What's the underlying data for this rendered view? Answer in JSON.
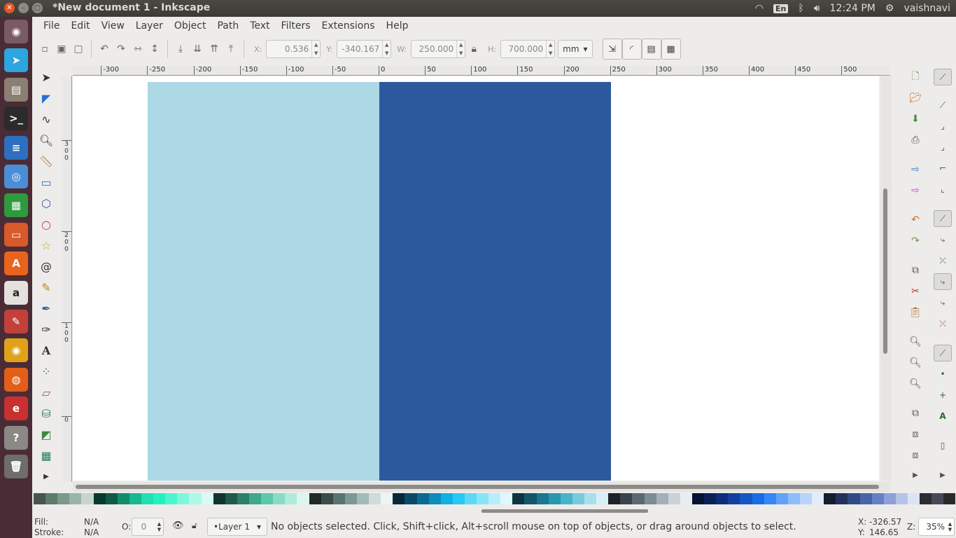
{
  "window": {
    "title": "*New document 1 - Inkscape"
  },
  "tray": {
    "lang": "En",
    "volume_icon": "speaker-icon",
    "time": "12:24 PM",
    "user": "vaishnavi"
  },
  "launcher": {
    "apps": [
      {
        "name": "ubuntu-dash",
        "glyph": "◉",
        "color": "#7a5a66"
      },
      {
        "name": "telegram",
        "glyph": "➤",
        "color": "#2ca5e0"
      },
      {
        "name": "files",
        "glyph": "▤",
        "color": "#8a7f72"
      },
      {
        "name": "terminal",
        "glyph": ">_",
        "color": "#2b2b2b"
      },
      {
        "name": "writer",
        "glyph": "≡",
        "color": "#2f6fbf"
      },
      {
        "name": "chromium",
        "glyph": "◎",
        "color": "#4a8fd6"
      },
      {
        "name": "calc",
        "glyph": "▦",
        "color": "#2e9a3e"
      },
      {
        "name": "impress",
        "glyph": "▭",
        "color": "#d8592a"
      },
      {
        "name": "software",
        "glyph": "A",
        "color": "#e8641e"
      },
      {
        "name": "amazon",
        "glyph": "a",
        "color": "#e4e1dc"
      },
      {
        "name": "settings",
        "glyph": "✎",
        "color": "#c2413a"
      },
      {
        "name": "chrome",
        "glyph": "◉",
        "color": "#e1a21b"
      },
      {
        "name": "firefox",
        "glyph": "◍",
        "color": "#e25f1a"
      },
      {
        "name": "evince",
        "glyph": "e",
        "color": "#c8312f"
      },
      {
        "name": "help",
        "glyph": "?",
        "color": "#8a8984"
      },
      {
        "name": "trash",
        "glyph": "🗑",
        "color": "#6e6d68"
      }
    ]
  },
  "menu": [
    "File",
    "Edit",
    "View",
    "Layer",
    "Object",
    "Path",
    "Text",
    "Filters",
    "Extensions",
    "Help"
  ],
  "controls": {
    "x_label": "X:",
    "x": "0.536",
    "y_label": "Y:",
    "y": "-340.167",
    "w_label": "W:",
    "w": "250.000",
    "h_label": "H:",
    "h": "700.000",
    "unit": "mm"
  },
  "ruler_top": [
    "-300",
    "-250",
    "-200",
    "-150",
    "-100",
    "-50",
    "0",
    "50",
    "100",
    "150",
    "200",
    "250",
    "300",
    "350",
    "400",
    "450",
    "500"
  ],
  "ruler_left": [
    "3\n0\n0",
    "2\n0\n0",
    "1\n0\n0",
    "0"
  ],
  "canvas": {
    "rect_light_color": "#add8e6",
    "rect_dark_color": "#2c599d"
  },
  "palette": [
    "#46564f",
    "#5d7a6a",
    "#7a9a8a",
    "#9ab5a8",
    "#c6d6ce",
    "#063a2e",
    "#0e5a44",
    "#128c6c",
    "#18b890",
    "#20e0b2",
    "#26f0c2",
    "#4ef4d0",
    "#80f6dc",
    "#b0f8e8",
    "#d8fbf3",
    "#10342e",
    "#1e5a4c",
    "#2a8068",
    "#3ea88c",
    "#5cc8ac",
    "#86dcc4",
    "#b0eada",
    "#dcf6ee",
    "#1e2a28",
    "#3a4c48",
    "#587470",
    "#7c9894",
    "#a4bab6",
    "#cedcda",
    "#eef4f3",
    "#08283a",
    "#0a4a66",
    "#0c6a92",
    "#0e8cbc",
    "#10b0e6",
    "#28c8f4",
    "#5cd8f6",
    "#8ae4f8",
    "#b8eefa",
    "#e0f8fc",
    "#0c3540",
    "#125668",
    "#1a7890",
    "#2898b0",
    "#48b4c8",
    "#76ccdc",
    "#a8e0ea",
    "#d6f0f4",
    "#1c2228",
    "#3a444c",
    "#5a6872",
    "#7c8c96",
    "#a2b0b8",
    "#c8d2d8",
    "#e8eef0",
    "#061434",
    "#0a2056",
    "#0e2e7a",
    "#12409e",
    "#1656c4",
    "#1a6ce6",
    "#3686f4",
    "#62a2f6",
    "#8ebcf8",
    "#b8d4fa",
    "#e0ecfc",
    "#141c30",
    "#22325a",
    "#324a84",
    "#4864a8",
    "#6680c4",
    "#8ea0d8",
    "#b6c4e8",
    "#dce4f4",
    "#2c2c34",
    "#48485a",
    "#2a2a2a"
  ],
  "status": {
    "fill_label": "Fill:",
    "fill_value": "N/A",
    "stroke_label": "Stroke:",
    "stroke_value": "N/A",
    "opacity_label": "O:",
    "opacity_value": "0",
    "layer": "•Layer 1",
    "message": "No objects selected. Click, Shift+click, Alt+scroll mouse on top of objects, or drag around objects to select.",
    "cursor_x_label": "X:",
    "cursor_x": "-326.57",
    "cursor_y_label": "Y:",
    "cursor_y": "146.65",
    "zoom_label": "Z:",
    "zoom": "35%"
  }
}
